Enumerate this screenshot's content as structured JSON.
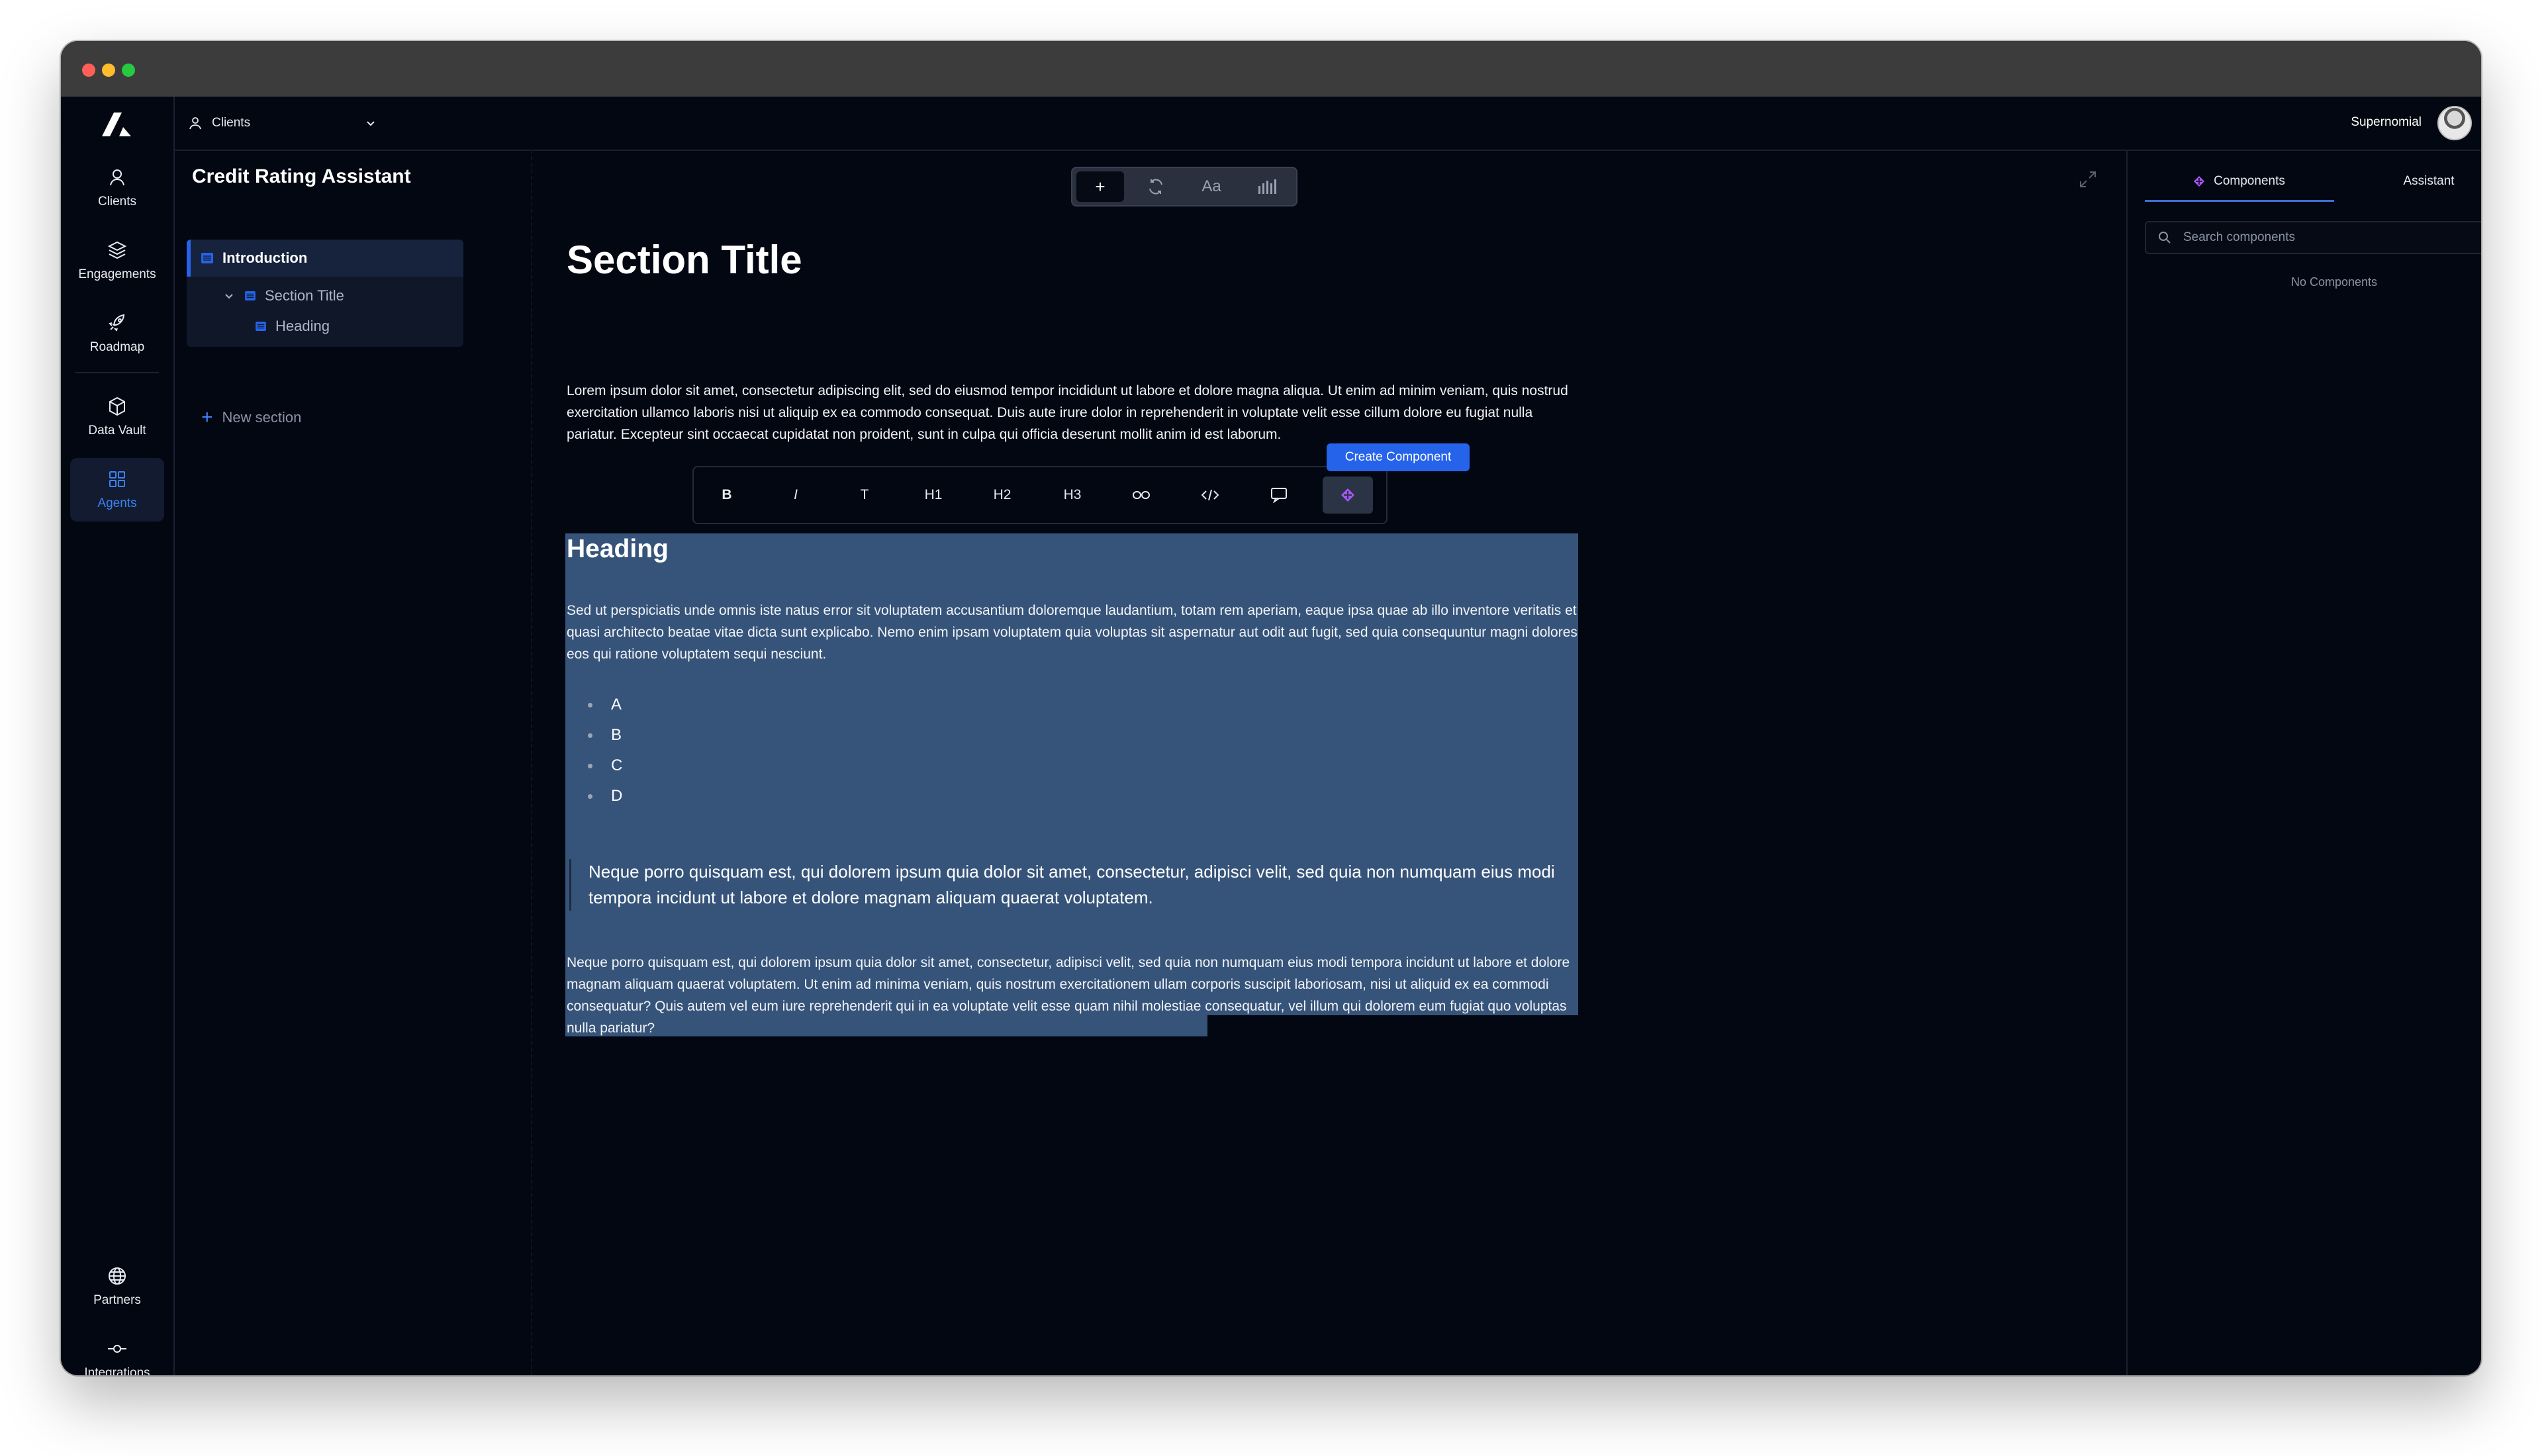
{
  "app": {
    "title": "Credit Rating Assistant",
    "user_name": "Supernomial",
    "client_selector": "Clients"
  },
  "nav": {
    "items": [
      {
        "label": "Clients",
        "icon": "user-icon"
      },
      {
        "label": "Engagements",
        "icon": "layers-icon"
      },
      {
        "label": "Roadmap",
        "icon": "rocket-icon"
      },
      {
        "label": "Data Vault",
        "icon": "box-icon"
      },
      {
        "label": "Agents",
        "icon": "grid-icon",
        "active": true
      }
    ],
    "bottom_items": [
      {
        "label": "Partners",
        "icon": "globe-icon"
      },
      {
        "label": "Integrations",
        "icon": "integration-icon"
      }
    ]
  },
  "outline": {
    "items": [
      {
        "label": "Introduction",
        "level": 0,
        "selected": true
      },
      {
        "label": "Section Title",
        "level": 1,
        "expanded": true
      },
      {
        "label": "Heading",
        "level": 2
      }
    ],
    "new_section": "New section"
  },
  "mini_toolbar": {
    "buttons": [
      {
        "glyph": "+",
        "icon": "plus-icon",
        "active": true
      },
      {
        "glyph": "⟳",
        "icon": "refresh-icon"
      },
      {
        "glyph": "Aa",
        "icon": "typography-icon"
      },
      {
        "glyph": "",
        "icon": "bars-icon"
      }
    ]
  },
  "format_toolbar": {
    "buttons": [
      {
        "label": "B",
        "icon": "bold-icon"
      },
      {
        "label": "I",
        "icon": "italic-icon"
      },
      {
        "label": "T",
        "icon": "text-icon"
      },
      {
        "label": "H1",
        "icon": "h1-icon"
      },
      {
        "label": "H2",
        "icon": "h2-icon"
      },
      {
        "label": "H3",
        "icon": "h3-icon"
      },
      {
        "label": "",
        "icon": "link-icon"
      },
      {
        "label": "",
        "icon": "code-icon"
      },
      {
        "label": "",
        "icon": "comment-icon"
      },
      {
        "label": "",
        "icon": "component-icon",
        "active": true
      }
    ],
    "create_component": "Create Component"
  },
  "document": {
    "title": "Section Title",
    "intro": "Lorem ipsum dolor sit amet, consectetur adipiscing elit, sed do eiusmod tempor incididunt ut labore et dolore magna aliqua. Ut enim ad minim veniam, quis nostrud exercitation ullamco laboris nisi ut aliquip ex ea commodo consequat. Duis aute irure dolor in reprehenderit in voluptate velit esse cillum dolore eu fugiat nulla pariatur. Excepteur sint occaecat cupidatat non proident, sunt in culpa qui officia deserunt mollit anim id est laborum.",
    "heading": "Heading",
    "para2": "Sed ut perspiciatis unde omnis iste natus error sit voluptatem accusantium doloremque laudantium, totam rem aperiam, eaque ipsa quae ab illo inventore veritatis et quasi architecto beatae vitae dicta sunt explicabo. Nemo enim ipsam voluptatem quia voluptas sit aspernatur aut odit aut fugit, sed quia consequuntur magni dolores eos qui ratione voluptatem sequi nesciunt.",
    "bullets": [
      "A",
      "B",
      "C",
      "D"
    ],
    "quote": "Neque porro quisquam est, qui dolorem ipsum quia dolor sit amet, consectetur, adipisci velit, sed quia non numquam eius modi tempora incidunt ut labore et dolore magnam aliquam quaerat voluptatem.",
    "para3": "Neque porro quisquam est, qui dolorem ipsum quia dolor sit amet, consectetur, adipisci velit, sed quia non numquam eius modi tempora incidunt ut labore et dolore magnam aliquam quaerat voluptatem. Ut enim ad minima veniam, quis nostrum exercitationem ullam corporis suscipit laboriosam, nisi ut aliquid ex ea commodi consequatur? Quis autem vel eum iure reprehenderit qui in ea voluptate velit esse quam nihil molestiae consequatur, vel illum qui dolorem eum fugiat quo voluptas nulla pariatur?"
  },
  "right_panel": {
    "tabs": [
      {
        "label": "Components",
        "icon": "component-icon",
        "active": true
      },
      {
        "label": "Assistant"
      }
    ],
    "search_placeholder": "Search components",
    "empty_text": "No Components"
  },
  "colors": {
    "accent": "#2563eb",
    "background": "#030712",
    "selection": "#365479"
  }
}
